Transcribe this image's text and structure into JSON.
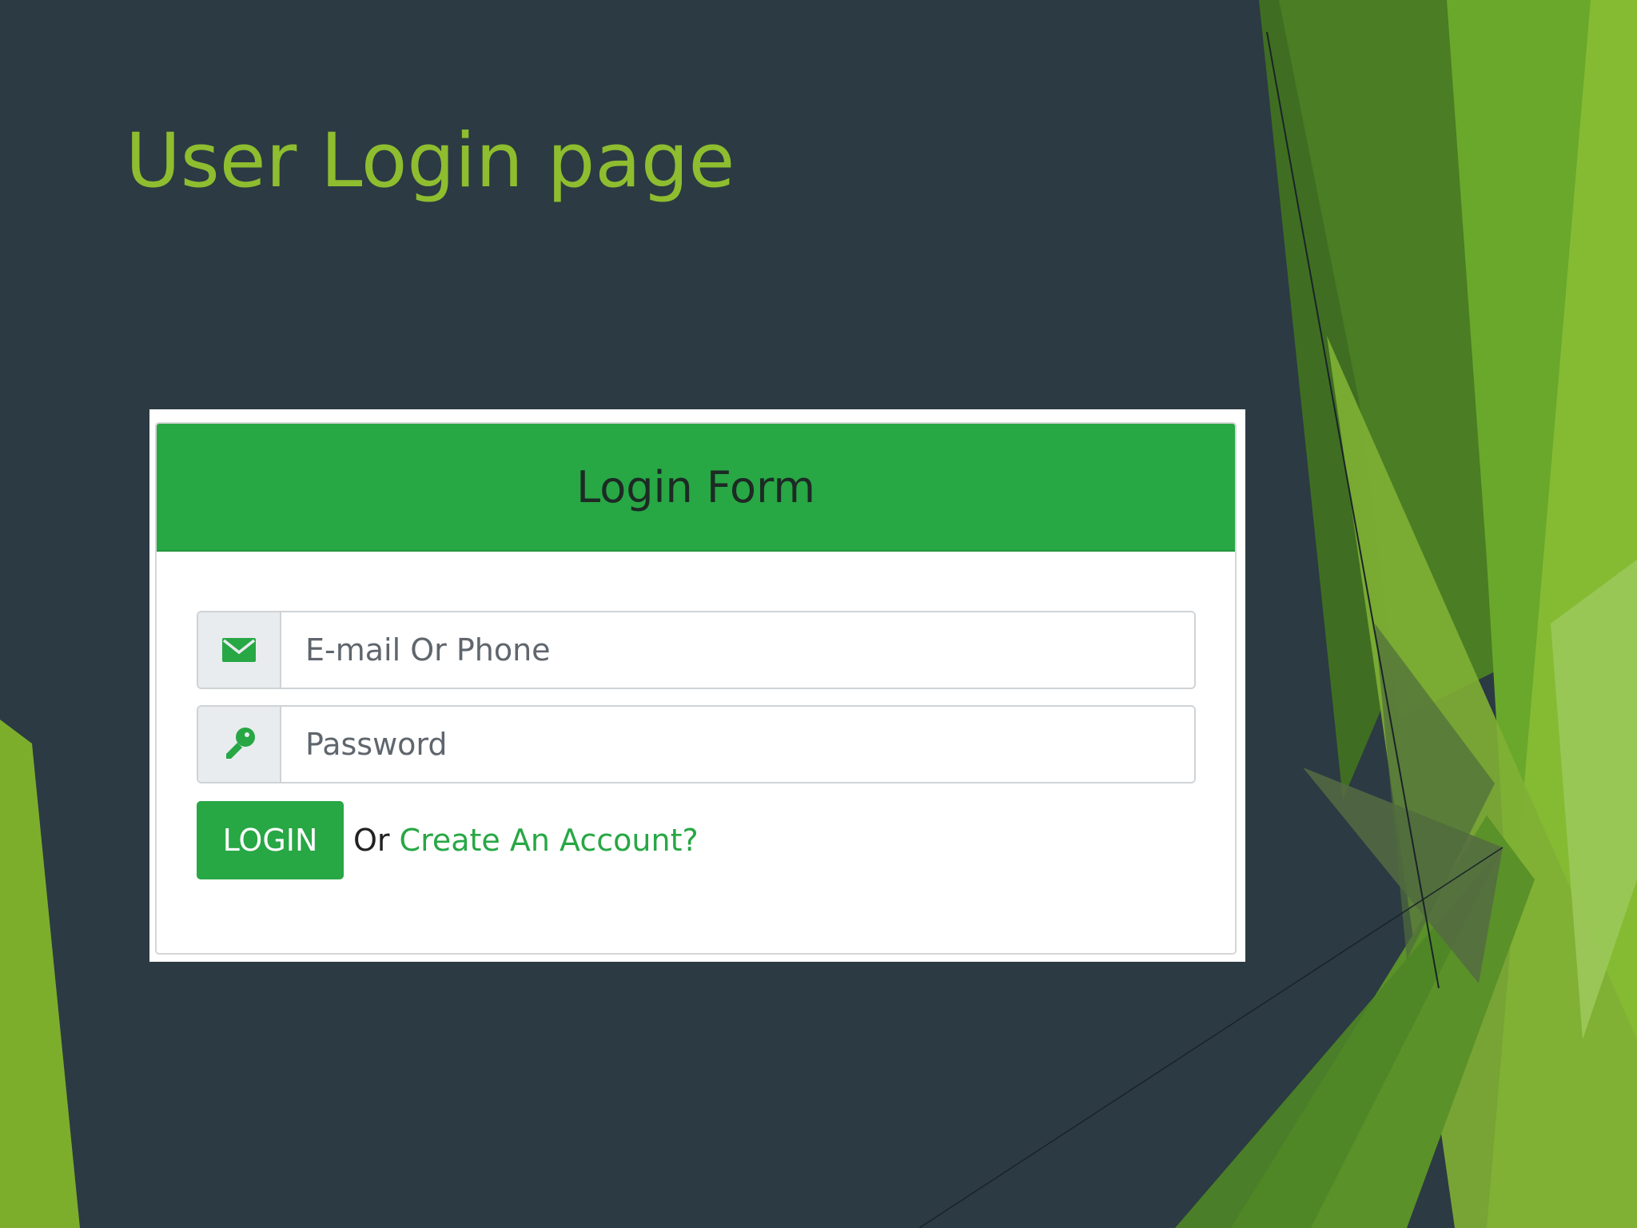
{
  "slide": {
    "title": "User Login page"
  },
  "form": {
    "header_title": "Login Form",
    "email": {
      "placeholder": "E-mail Or Phone",
      "icon": "envelope-icon"
    },
    "password": {
      "placeholder": "Password",
      "icon": "key-icon"
    },
    "login_label": "LOGIN",
    "or_text": "Or",
    "create_account_label": "Create An Account?"
  },
  "colors": {
    "slide_background": "#2c3a43",
    "title_green": "#8ebd2f",
    "brand_green": "#28a745",
    "addon_background": "#e9ecef"
  }
}
